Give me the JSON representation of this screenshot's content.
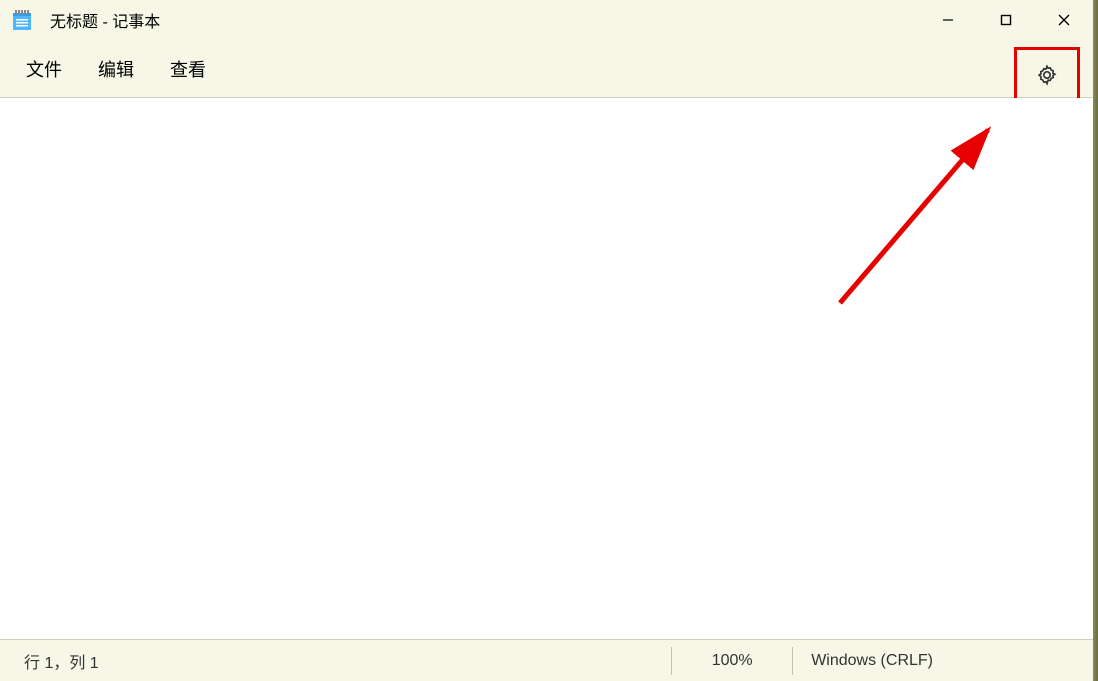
{
  "titlebar": {
    "title": "无标题 - 记事本"
  },
  "menubar": {
    "file": "文件",
    "edit": "编辑",
    "view": "查看"
  },
  "annotation": {
    "highlight_color": "#e60000"
  },
  "statusbar": {
    "position": "行 1，列 1",
    "zoom": "100%",
    "encoding": "Windows (CRLF)"
  }
}
